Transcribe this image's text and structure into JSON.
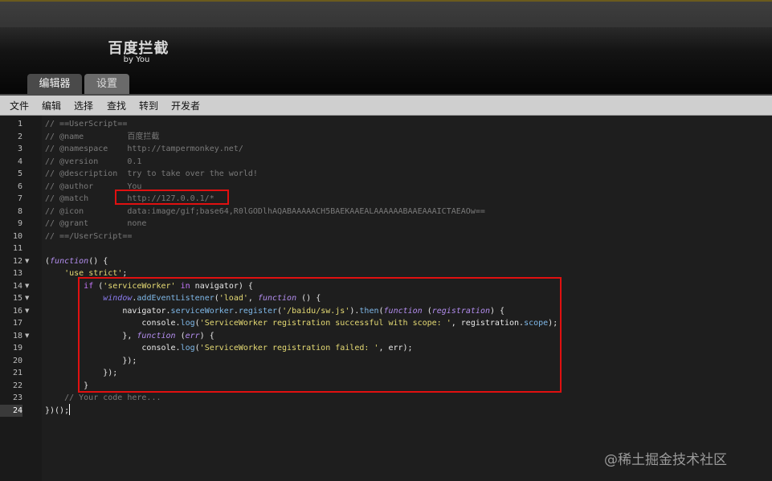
{
  "header": {
    "script_name": "百度拦截",
    "author_line": "by You"
  },
  "tabs": [
    {
      "label": "编辑器",
      "active": true
    },
    {
      "label": "设置",
      "active": false
    }
  ],
  "menu": [
    "文件",
    "编辑",
    "选择",
    "查找",
    "转到",
    "开发者"
  ],
  "editor": {
    "current_line": 24,
    "lines": [
      {
        "n": "1"
      },
      {
        "n": "2"
      },
      {
        "n": "3"
      },
      {
        "n": "4"
      },
      {
        "n": "5"
      },
      {
        "n": "6"
      },
      {
        "n": "7"
      },
      {
        "n": "8"
      },
      {
        "n": "9"
      },
      {
        "n": "10"
      },
      {
        "n": "11"
      },
      {
        "n": "12"
      },
      {
        "n": "13"
      },
      {
        "n": "14"
      },
      {
        "n": "15"
      },
      {
        "n": "16"
      },
      {
        "n": "17"
      },
      {
        "n": "18"
      },
      {
        "n": "19"
      },
      {
        "n": "20"
      },
      {
        "n": "21"
      },
      {
        "n": "22"
      },
      {
        "n": "23"
      },
      {
        "n": "24"
      }
    ],
    "fold_lines": [
      "12",
      "14",
      "15",
      "16",
      "18"
    ],
    "fold_icon": "triangle-down-icon",
    "code": {
      "l1": "// ==UserScript==",
      "l2": "// @name         百度拦截",
      "l3": "// @namespace    http://tampermonkey.net/",
      "l4": "// @version      0.1",
      "l5": "// @description  try to take over the world!",
      "l6": "// @author       You",
      "l7": "// @match        http://127.0.0.1/*",
      "l8": "// @icon         data:image/gif;base64,R0lGODlhAQABAAAAACH5BAEKAAEALAAAAAABAAEAAAICTAEAOw==",
      "l9": "// @grant        none",
      "l10": "// ==/UserScript==",
      "l23": "    // Your code here..."
    }
  },
  "annotation_color": "#e01010",
  "watermark": "@稀土掘金技术社区"
}
